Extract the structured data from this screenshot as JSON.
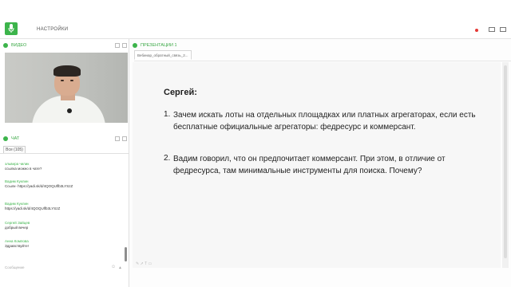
{
  "app": {
    "brand_color": "#3cb44b",
    "settings_label": "НАСТРОЙКИ"
  },
  "video_panel": {
    "title": "ВИДЕО",
    "icon": "video-icon"
  },
  "presentation_panel": {
    "title": "ПРЕЗЕНТАЦИИ 1",
    "tab_label": "Вебинар_обратный_связь_2..."
  },
  "chat": {
    "title": "ЧАТ",
    "tab_all": "Все (105)",
    "placeholder": "Сообщение",
    "messages": [
      {
        "name": "эльвира чилик",
        "time": "(19:06)",
        "text": "ссылка можно в чате?"
      },
      {
        "name": "Вадим Куклин",
        "time": "(19:06)",
        "text": "Ссылк- https://yadi.sk/d/4QOQUlfb3LYSzZ"
      },
      {
        "name": "Вадим Куклин",
        "time": "(19:06)",
        "text": "https://yadi.sk/d/4QOQUlfb3LYSzZ"
      },
      {
        "name": "Сергей Зайцев",
        "time": "(19:06)",
        "text": "добрый вечер"
      },
      {
        "name": "Анна Компова",
        "time": "(19:11)",
        "text": "Здравствуйте!"
      }
    ]
  },
  "slide": {
    "title": "Сергей:",
    "items": [
      {
        "num": "1.",
        "text": "Зачем искать лоты на отдельных площадках или платных агрегаторах, если есть бесплатные официальные агрегаторы: федресурс и коммерсант."
      },
      {
        "num": "2.",
        "text": "Вадим говорил, что он предпочитает коммерсант. При этом, в отличие от федресурса, там минимальные инструменты для поиска. Почему?"
      }
    ]
  }
}
